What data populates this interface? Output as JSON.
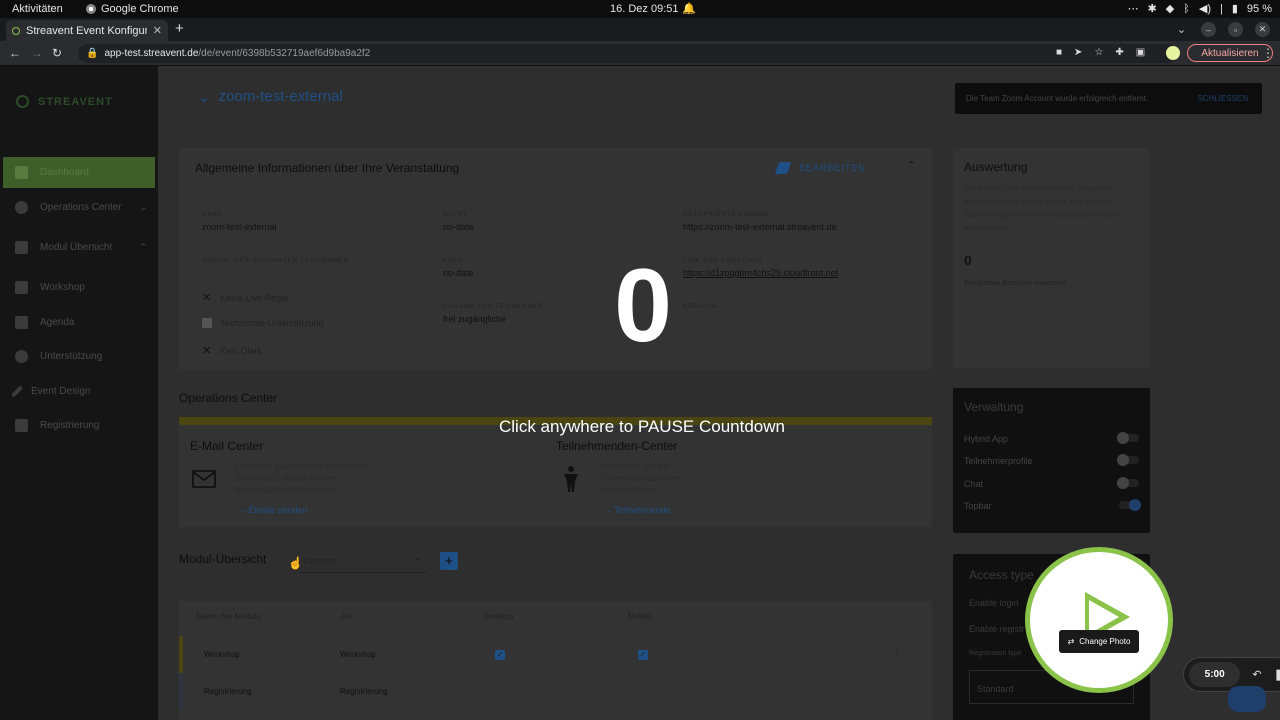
{
  "os": {
    "activities": "Aktivitäten",
    "app_name": "Google Chrome",
    "clock": "16. Dez  09:51",
    "battery": "95 %"
  },
  "browser": {
    "tab_title": "Streavent Event Konfigura",
    "url_host": "app-test.streavent.de",
    "url_path": "/de/event/6398b532719aef6d9ba9a2f2",
    "update_label": "Aktualisieren"
  },
  "sidebar": {
    "logo_text": "STREAVENT",
    "items": [
      {
        "label": "Dashboard",
        "icon": "home-icon"
      },
      {
        "label": "Operations Center",
        "icon": "radar-icon"
      },
      {
        "label": "Modul Übersicht",
        "icon": "grid-icon"
      },
      {
        "label": "Workshop",
        "icon": "people-icon"
      },
      {
        "label": "Agenda",
        "icon": "calendar-icon"
      },
      {
        "label": "Unterstützung",
        "icon": "help-icon"
      },
      {
        "label": "Event Design",
        "icon": "brush-icon"
      },
      {
        "label": "Registrierung",
        "icon": "ticket-icon"
      }
    ]
  },
  "event": {
    "title": "zoom-test-external"
  },
  "info": {
    "heading": "Allgemeine Informationen über Ihre Veranstaltung",
    "edit_label": "BEARBEITEN",
    "name_label": "NAME",
    "name_value": "zoom-test-external",
    "start_label": "START",
    "start_value": "no-date",
    "domain_label": "RESERVIERTE DOMAIN",
    "domain_value": "https://zoom-test-external.streavent.de",
    "participants_label": "ANZAHL DER GEPLANTEN TEILNEHMER",
    "end_label": "ENDE",
    "end_value": "no-date",
    "preview_label": "LINK ZUR VORSCHAU",
    "preview_value": "https://d1zpqgbm4chs29.cloudfront.net",
    "access_label": "ZUGANG FÜR TEILNEHMER",
    "access_value": "frei zugängliche",
    "language_label": "SPRACHE",
    "checks": [
      "Keine Live Regie",
      "Technische Unterstützung",
      "Kein Olark"
    ]
  },
  "ops": {
    "title": "Operations Center",
    "email_title": "E-Mail Center",
    "email_desc": "Erstellen, planen oder versenden Sie sofort E-Mails an Ihre Veranstaltungsteilnehmer.",
    "email_link": "Emails senden",
    "participants_title": "Teilnehmenden-Center",
    "participants_desc": "Verwalten Sie die Teilnehmenden Ihrer Veranstaltung.",
    "participants_link": "Teilnehmende"
  },
  "modules": {
    "title": "Modul-Übersicht",
    "select_value": "Keynote",
    "add_label": "+",
    "headers": [
      "Name des Moduls",
      "Art",
      "Desktop",
      "Mobile"
    ],
    "rows": [
      {
        "name": "Workshop",
        "type": "Workshop"
      },
      {
        "name": "Registrierung",
        "type": "Registrierung"
      }
    ]
  },
  "toast": {
    "message": "Die Team Zoom Account wurde erfolgreich entfernt.",
    "action": "SCHLIESSEN"
  },
  "evaluation": {
    "title": "Auswertung",
    "text": "Wir haben Ihre Veranstaltung analysiert. Klicken Sie auf diese Karte, um sich die Auswertung Ihrer Veranstaltung im Detail anzusehen.",
    "count": "0",
    "count_label": "Einzigartige Besucher insgesamt"
  },
  "admin": {
    "title": "Verwaltung",
    "toggles": [
      {
        "label": "Hybrid App",
        "on": false
      },
      {
        "label": "Teilnehmerprofile",
        "on": false
      },
      {
        "label": "Chat",
        "on": false
      },
      {
        "label": "Topbar",
        "on": true
      }
    ]
  },
  "access": {
    "title": "Access type",
    "row1": "Enable login",
    "row2": "Enable registr",
    "row3": "Registration type",
    "select_value": "Standard"
  },
  "countdown": {
    "number": "0",
    "hint": "Click anywhere to PAUSE Countdown"
  },
  "camera": {
    "change_photo": "Change Photo"
  },
  "timer": {
    "time": "5:00"
  }
}
